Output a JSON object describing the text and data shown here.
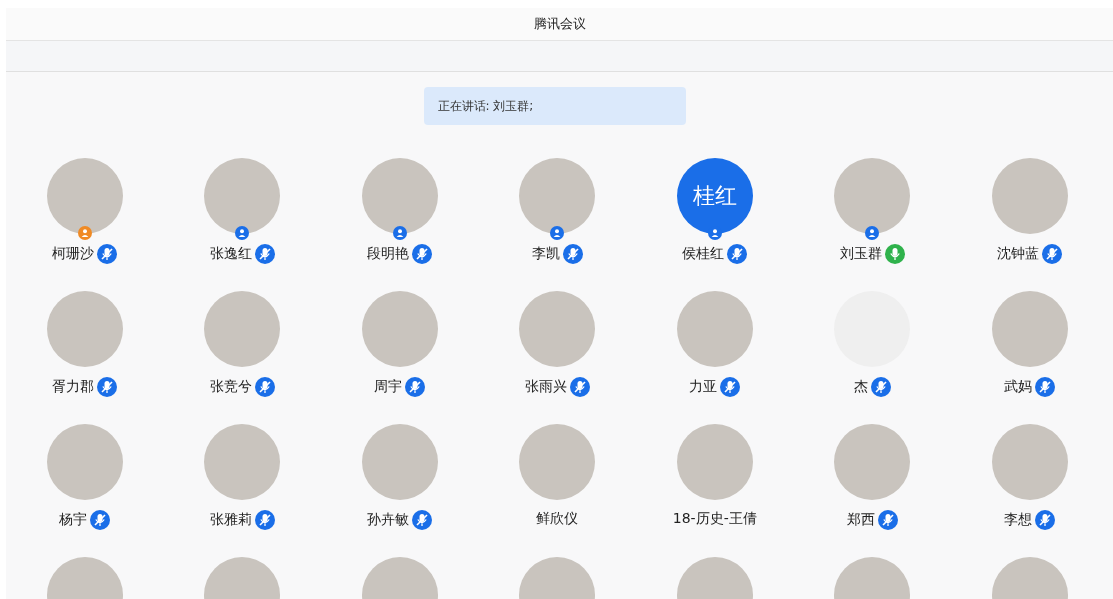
{
  "window": {
    "title": "腾讯会议"
  },
  "speaking_banner": {
    "text": "正在讲话: 刘玉群;"
  },
  "participants": [
    {
      "name": "柯珊沙",
      "avatar": {
        "kind": "image"
      },
      "badge": {
        "host": true
      },
      "mic": {
        "speaking": false
      }
    },
    {
      "name": "张逸红",
      "avatar": {
        "kind": "image"
      },
      "badge": {
        "host": false
      },
      "mic": {
        "speaking": false
      }
    },
    {
      "name": "段明艳",
      "avatar": {
        "kind": "image"
      },
      "badge": {
        "host": false
      },
      "mic": {
        "speaking": false
      }
    },
    {
      "name": "李凯",
      "avatar": {
        "kind": "image"
      },
      "badge": {
        "host": false
      },
      "mic": {
        "speaking": false
      }
    },
    {
      "name": "侯桂红",
      "avatar": {
        "kind": "text",
        "text": "桂红"
      },
      "badge": {
        "host": false
      },
      "mic": {
        "speaking": false
      }
    },
    {
      "name": "刘玉群",
      "avatar": {
        "kind": "image"
      },
      "badge": {
        "host": false
      },
      "mic": {
        "speaking": true
      }
    },
    {
      "name": "沈钟蓝",
      "avatar": {
        "kind": "image"
      },
      "mic": {
        "speaking": false
      }
    },
    {
      "name": "胥力郡",
      "avatar": {
        "kind": "image"
      },
      "mic": {
        "speaking": false
      }
    },
    {
      "name": "张竞兮",
      "avatar": {
        "kind": "image"
      },
      "mic": {
        "speaking": false
      }
    },
    {
      "name": "周宇",
      "avatar": {
        "kind": "image"
      },
      "mic": {
        "speaking": false
      }
    },
    {
      "name": "张雨兴",
      "avatar": {
        "kind": "image"
      },
      "mic": {
        "speaking": false
      }
    },
    {
      "name": "力亚",
      "avatar": {
        "kind": "image"
      },
      "mic": {
        "speaking": false
      }
    },
    {
      "name": "杰",
      "avatar": {
        "kind": "blank"
      },
      "mic": {
        "speaking": false
      }
    },
    {
      "name": "武妈",
      "avatar": {
        "kind": "image"
      },
      "mic": {
        "speaking": false
      }
    },
    {
      "name": "杨宇",
      "avatar": {
        "kind": "image"
      },
      "mic": {
        "speaking": false
      }
    },
    {
      "name": "张雅莉",
      "avatar": {
        "kind": "image"
      },
      "mic": {
        "speaking": false
      }
    },
    {
      "name": "孙卉敏",
      "avatar": {
        "kind": "image"
      },
      "mic": {
        "speaking": false
      }
    },
    {
      "name": "鲜欣仪",
      "avatar": {
        "kind": "image"
      }
    },
    {
      "name": "18-历史-王倩",
      "avatar": {
        "kind": "image"
      }
    },
    {
      "name": "郑西",
      "avatar": {
        "kind": "image"
      },
      "mic": {
        "speaking": false
      }
    },
    {
      "name": "李想",
      "avatar": {
        "kind": "image"
      },
      "mic": {
        "speaking": false
      }
    },
    {
      "avatar": {
        "kind": "image"
      }
    },
    {
      "avatar": {
        "kind": "image"
      }
    },
    {
      "avatar": {
        "kind": "image"
      }
    },
    {
      "avatar": {
        "kind": "image"
      }
    },
    {
      "avatar": {
        "kind": "image"
      }
    },
    {
      "avatar": {
        "kind": "image"
      }
    },
    {
      "avatar": {
        "kind": "image"
      }
    }
  ]
}
